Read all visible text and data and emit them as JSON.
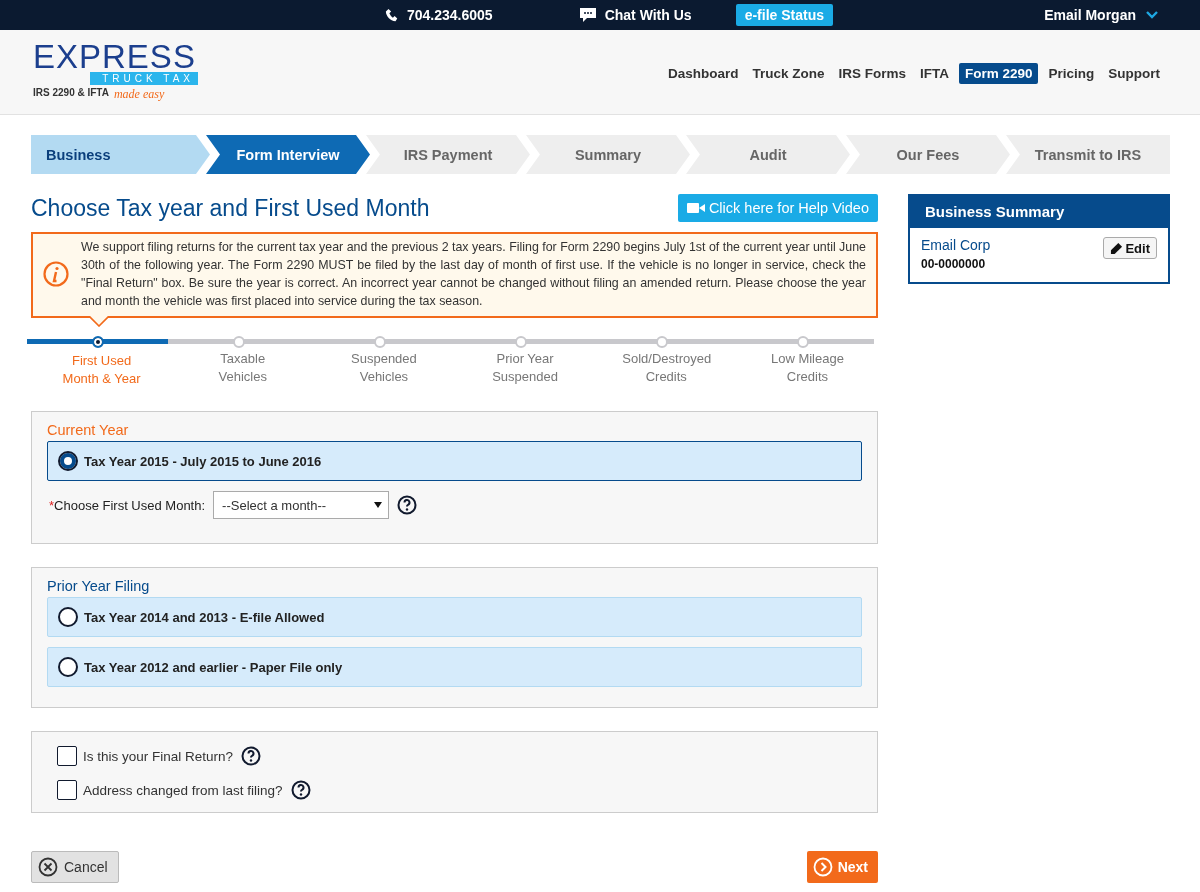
{
  "top_bar": {
    "phone": "704.234.6005",
    "chat": "Chat With Us",
    "status_button": "e-file Status",
    "account": "Email Morgan"
  },
  "logo": {
    "word": "EXPRESS",
    "band": "TRUCK TAX",
    "tagline": "IRS 2290 & IFTA",
    "slogan": "made easy"
  },
  "nav": [
    {
      "label": "Dashboard",
      "selected": false
    },
    {
      "label": "Truck Zone",
      "selected": false
    },
    {
      "label": "IRS Forms",
      "selected": false
    },
    {
      "label": "IFTA",
      "selected": false
    },
    {
      "label": "Form 2290",
      "selected": true
    },
    {
      "label": "Pricing",
      "selected": false
    },
    {
      "label": "Support",
      "selected": false
    }
  ],
  "wizard_steps": [
    {
      "label": "Business",
      "completed": true,
      "selected": false
    },
    {
      "label": "Form Interview",
      "completed": false,
      "selected": true
    },
    {
      "label": "IRS Payment",
      "completed": false,
      "selected": false
    },
    {
      "label": "Summary",
      "completed": false,
      "selected": false
    },
    {
      "label": "Audit",
      "completed": false,
      "selected": false
    },
    {
      "label": "Our Fees",
      "completed": false,
      "selected": false
    },
    {
      "label": "Transmit to IRS",
      "completed": false,
      "selected": false
    }
  ],
  "page_title": "Choose Tax year and First Used Month",
  "help_video_button": "Click here for Help Video",
  "notice": "We support filing returns for the current tax year and the previous 2 tax years. Filing for Form 2290 begins July 1st of the current year until June 30th of the following year. The Form 2290 MUST be filed by the last day of month of first use. If the vehicle is no longer in service, check the \"Final Return\" box. Be sure the year is correct. An incorrect year cannot be changed without filing an amended return. Please choose the year and month the vehicle was first placed into service during the tax season.",
  "sub_steps": [
    {
      "label": "First Used Month & Year",
      "selected": true
    },
    {
      "label": "Taxable Vehicles",
      "selected": false
    },
    {
      "label": "Suspended Vehicles",
      "selected": false
    },
    {
      "label": "Prior Year Suspended",
      "selected": false
    },
    {
      "label": "Sold/Destroyed Credits",
      "selected": false
    },
    {
      "label": "Low Mileage Credits",
      "selected": false
    }
  ],
  "current_year": {
    "heading": "Current Year",
    "options": [
      {
        "label": "Tax Year 2015 - July 2015 to June 2016",
        "selected": true
      }
    ],
    "required_mark": "*",
    "month_label": "Choose First Used Month:",
    "month_value": "--Select a month--"
  },
  "prior_year": {
    "heading": "Prior Year Filing",
    "options": [
      {
        "label": "Tax Year 2014 and 2013 - E-file Allowed",
        "selected": false
      },
      {
        "label": "Tax Year 2012 and earlier - Paper File only",
        "selected": false
      }
    ]
  },
  "checkboxes": [
    {
      "label": "Is this your Final Return?",
      "checked": false
    },
    {
      "label": "Address changed from last filing?",
      "checked": false
    }
  ],
  "buttons": {
    "cancel": "Cancel",
    "next": "Next"
  },
  "business_summary": {
    "title": "Business Summary",
    "name": "Email Corp",
    "ein": "00-0000000",
    "edit": "Edit"
  }
}
